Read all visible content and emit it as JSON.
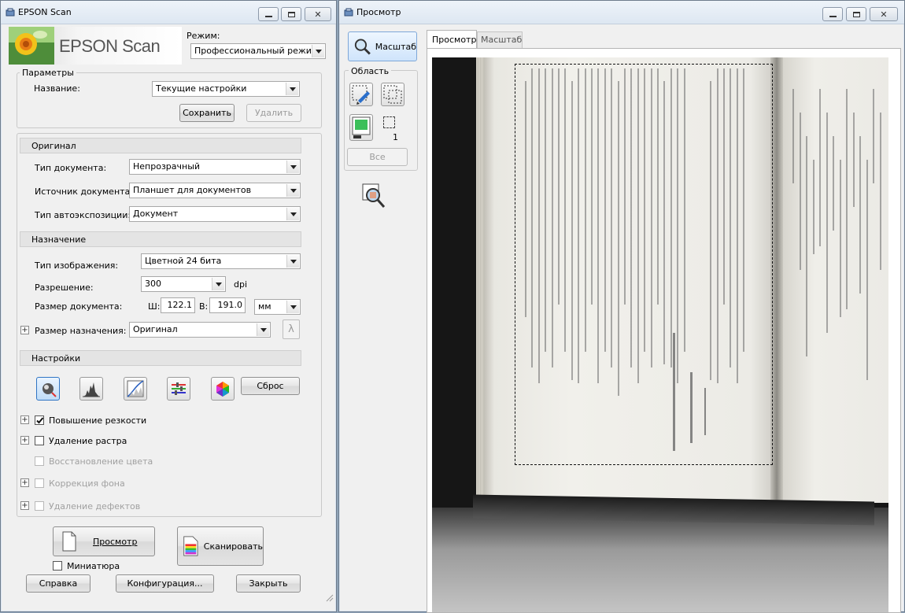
{
  "main_window": {
    "title": "EPSON Scan",
    "logo_text": "EPSON Scan",
    "mode_label": "Режим:",
    "mode_value": "Профессиональный режим",
    "params": {
      "group_label": "Параметры",
      "name_label": "Название:",
      "name_value": "Текущие настройки",
      "save_label": "Сохранить",
      "delete_label": "Удалить"
    },
    "original": {
      "header": "Оригинал",
      "doc_type_label": "Тип документа:",
      "doc_type_value": "Непрозрачный",
      "doc_source_label": "Источник документа:",
      "doc_source_value": "Планшет для документов",
      "autoexp_label": "Тип автоэкспозиции:",
      "autoexp_value": "Документ"
    },
    "destination": {
      "header": "Назначение",
      "image_type_label": "Тип изображения:",
      "image_type_value": "Цветной 24 бита",
      "resolution_label": "Разрешение:",
      "resolution_value": "300",
      "resolution_unit": "dpi",
      "doc_size_label": "Размер документа:",
      "width_label": "Ш:",
      "width_value": "122.1",
      "height_label": "В:",
      "height_value": "191.0",
      "size_unit": "мм",
      "target_size_label": "Размер назначения:",
      "target_size_value": "Оригинал"
    },
    "settings": {
      "header": "Настройки",
      "reset_label": "Сброс",
      "options": [
        {
          "label": "Повышение резкости",
          "checked": true,
          "enabled": true,
          "expander": true
        },
        {
          "label": "Удаление растра",
          "checked": false,
          "enabled": true,
          "expander": true
        },
        {
          "label": "Восстановление цвета",
          "checked": false,
          "enabled": false,
          "expander": false
        },
        {
          "label": "Коррекция фона",
          "checked": false,
          "enabled": false,
          "expander": true
        },
        {
          "label": "Удаление дефектов",
          "checked": false,
          "enabled": false,
          "expander": true
        }
      ]
    },
    "preview_button": "Просмотр",
    "scan_button": "Сканировать",
    "thumbnail_label": "Миниатюра",
    "help_button": "Справка",
    "config_button": "Конфигурация...",
    "close_button": "Закрыть"
  },
  "preview_window": {
    "title": "Просмотр",
    "zoom_button": "Масштаб",
    "area_label": "Область",
    "count_value": "1",
    "all_button": "Все",
    "tabs": [
      "Просмотр",
      "Масштаб"
    ],
    "active_tab": 0
  },
  "colors": {
    "title_gradient_top": "#eef3f9",
    "window_bg": "#f0f0f0",
    "preview_bg": "#161616",
    "page_bg": "#ecebe6"
  }
}
